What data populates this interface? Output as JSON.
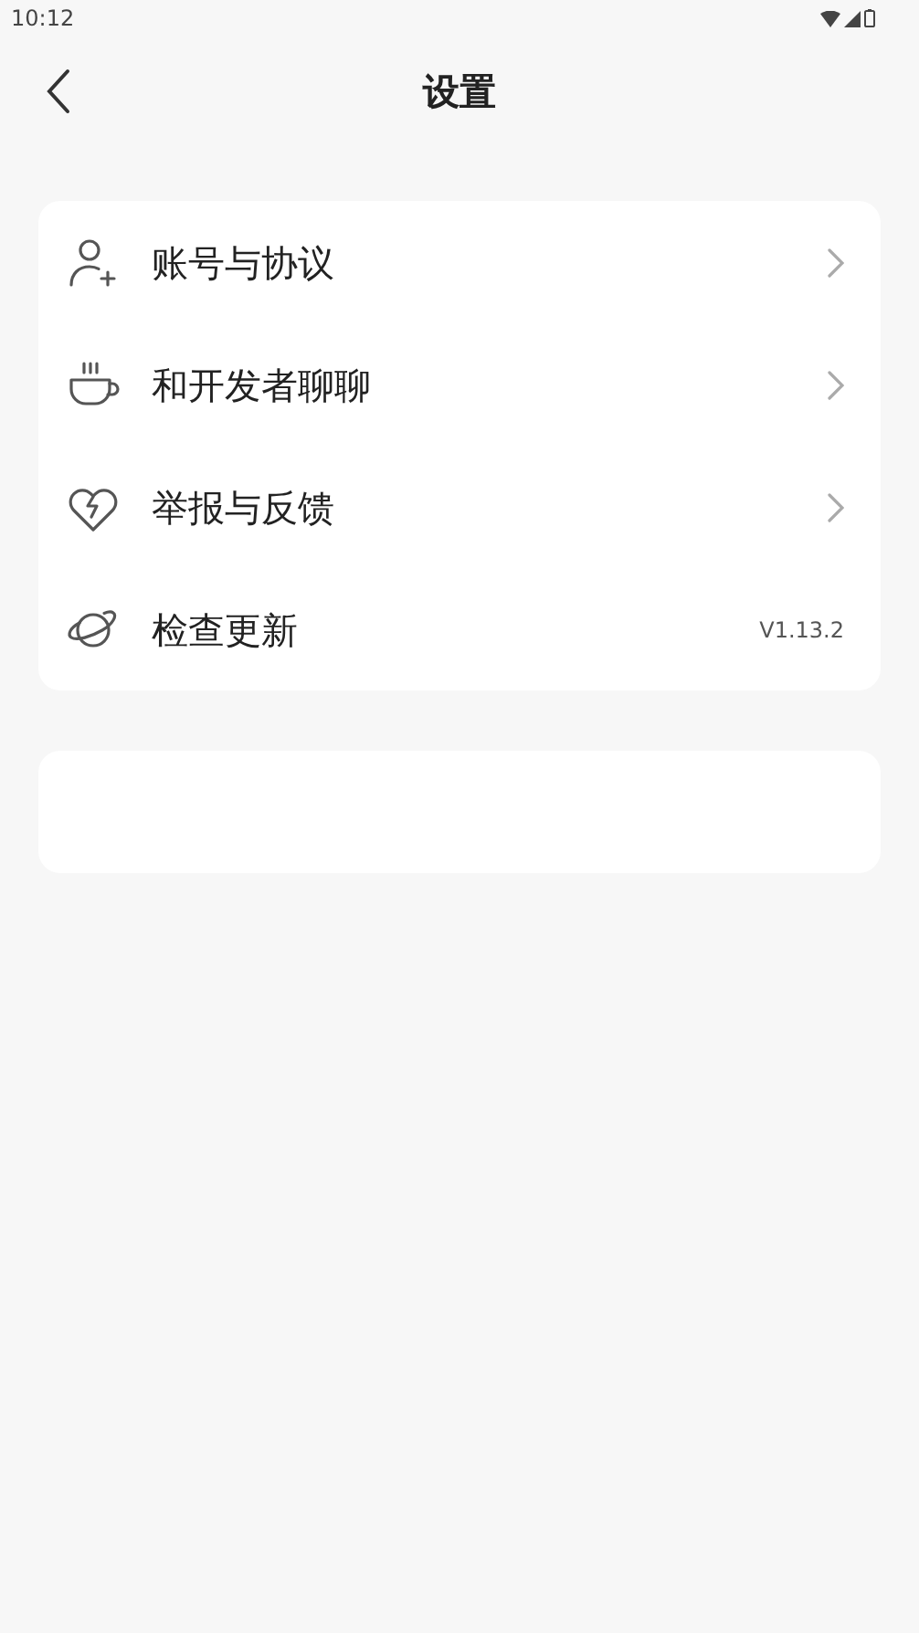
{
  "status_bar": {
    "time": "10:12"
  },
  "header": {
    "title": "设置"
  },
  "items": [
    {
      "label": "账号与协议",
      "kind": "arrow"
    },
    {
      "label": "和开发者聊聊",
      "kind": "arrow"
    },
    {
      "label": "举报与反馈",
      "kind": "arrow"
    },
    {
      "label": "检查更新",
      "kind": "value",
      "value": "V1.13.2"
    }
  ]
}
